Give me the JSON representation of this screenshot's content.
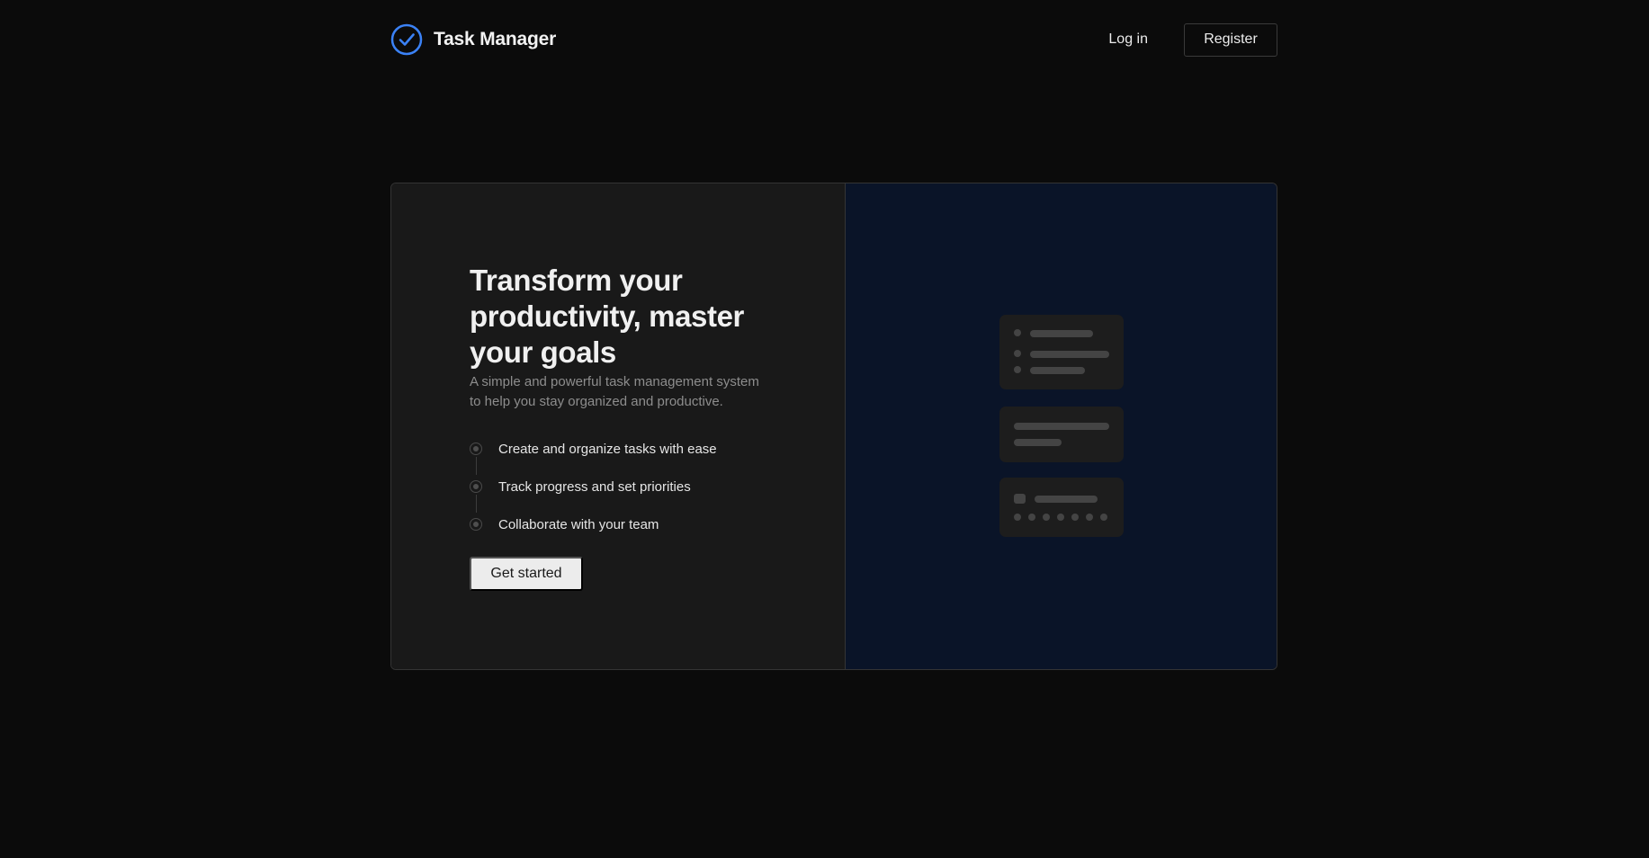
{
  "app": {
    "name": "Task Manager",
    "logo_icon": "check-circle-icon",
    "accent_color": "#3b82f6"
  },
  "nav": {
    "login_label": "Log in",
    "register_label": "Register"
  },
  "hero": {
    "title": "Transform your productivity, master your goals",
    "subtitle": "A simple and powerful task management system to help you stay organized and productive.",
    "features": [
      {
        "label": "Create and organize tasks with ease"
      },
      {
        "label": "Track progress and set priorities"
      },
      {
        "label": "Collaborate with your team"
      }
    ],
    "cta_label": "Get started"
  },
  "colors": {
    "page_background": "#0b0b0b",
    "left_panel": "#191919",
    "right_panel": "#0a1428"
  }
}
